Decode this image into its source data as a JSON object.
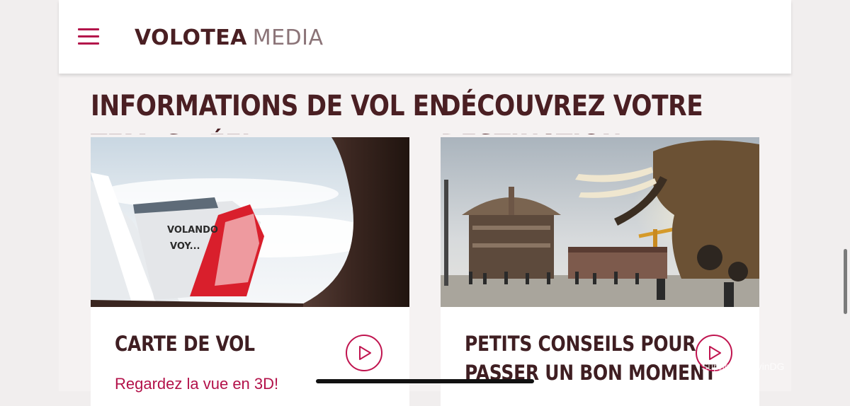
{
  "header": {
    "menu_icon": "hamburger-menu-icon",
    "logo_main": "VOLOTEA",
    "logo_sub": "MEDIA"
  },
  "sections": {
    "left_heading_line1": "INFORMATIONS DE VOL EN",
    "left_heading_line2": "TEMPS RÉEL",
    "right_heading_line1": "DÉCOUVREZ VOTRE",
    "right_heading_line2": "DESTINATION"
  },
  "cards": [
    {
      "title": "CARTE DE VOL",
      "subtitle": "Regardez la vue en 3D!",
      "image_text_line1": "VOLANDO",
      "image_text_line2": "VOY...",
      "icon": "play-icon"
    },
    {
      "title_line1": "PETITS CONSEILS POUR",
      "title_line2": "PASSER UN BON MOMENT",
      "icon": "play-icon"
    }
  ],
  "watermark": "Support - KevinDG",
  "colors": {
    "accent": "#b3124a",
    "heading": "#4a1f23",
    "background": "#f5f2f2"
  }
}
